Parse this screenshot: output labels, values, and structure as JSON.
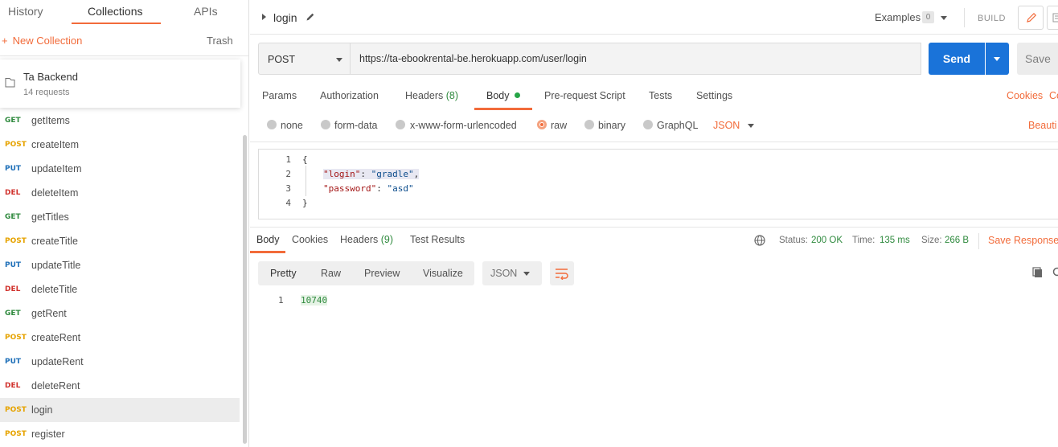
{
  "sidebar": {
    "tabs": {
      "history": "History",
      "collections": "Collections",
      "apis": "APIs"
    },
    "new_collection": "New Collection",
    "trash": "Trash",
    "collection": {
      "name": "Ta Backend",
      "count": "14 requests"
    },
    "requests": [
      {
        "method": "GET",
        "name": "getItems"
      },
      {
        "method": "POST",
        "name": "createItem"
      },
      {
        "method": "PUT",
        "name": "updateItem"
      },
      {
        "method": "DEL",
        "name": "deleteItem"
      },
      {
        "method": "GET",
        "name": "getTitles"
      },
      {
        "method": "POST",
        "name": "createTitle"
      },
      {
        "method": "PUT",
        "name": "updateTitle"
      },
      {
        "method": "DEL",
        "name": "deleteTitle"
      },
      {
        "method": "GET",
        "name": "getRent"
      },
      {
        "method": "POST",
        "name": "createRent"
      },
      {
        "method": "PUT",
        "name": "updateRent"
      },
      {
        "method": "DEL",
        "name": "deleteRent"
      },
      {
        "method": "POST",
        "name": "login"
      },
      {
        "method": "POST",
        "name": "register"
      }
    ]
  },
  "request": {
    "title": "login",
    "examples_label": "Examples",
    "examples_count": "0",
    "build_label": "BUILD",
    "method": "POST",
    "url": "https://ta-ebookrental-be.herokuapp.com/user/login",
    "send": "Send",
    "save": "Save",
    "tabs": {
      "params": "Params",
      "authorization": "Authorization",
      "headers": "Headers",
      "headers_count": "(8)",
      "body": "Body",
      "prerequest": "Pre-request Script",
      "tests": "Tests",
      "settings": "Settings"
    },
    "cookies_link": "Cookies",
    "code_link": "Co",
    "body_types": {
      "none": "none",
      "form_data": "form-data",
      "urlencoded": "x-www-form-urlencoded",
      "raw": "raw",
      "binary": "binary",
      "graphql": "GraphQL",
      "format": "JSON"
    },
    "beautify": "Beauti",
    "body_lines": {
      "n1": "1",
      "n2": "2",
      "n3": "3",
      "n4": "4",
      "l1": "{",
      "l2_key": "\"login\"",
      "l2_sep": ": ",
      "l2_val": "\"gradle\"",
      "l2_end": ",",
      "l3_key": "\"password\"",
      "l3_sep": ": ",
      "l3_val": "\"asd\"",
      "l4": "}"
    }
  },
  "response": {
    "tabs": {
      "body": "Body",
      "cookies": "Cookies",
      "headers": "Headers",
      "headers_count": "(9)",
      "test_results": "Test Results"
    },
    "status_label": "Status:",
    "status_value": "200 OK",
    "time_label": "Time:",
    "time_value": "135 ms",
    "size_label": "Size:",
    "size_value": "266 B",
    "save_response": "Save Response",
    "view": {
      "pretty": "Pretty",
      "raw": "Raw",
      "preview": "Preview",
      "visualize": "Visualize",
      "format": "JSON"
    },
    "line_number": "1",
    "value": "10740"
  },
  "colors": {
    "accent": "#f26b3a",
    "send_blue": "#1a73d9",
    "get": "#2f8a3e",
    "post": "#e6a300",
    "put": "#1e6fb8",
    "del": "#d1332e"
  }
}
